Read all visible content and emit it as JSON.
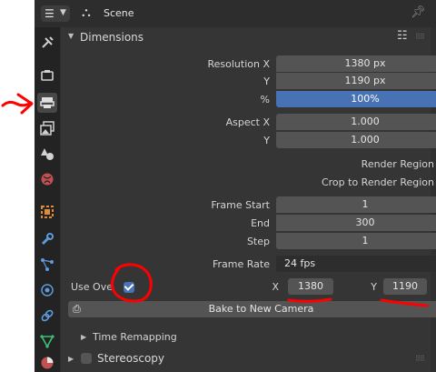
{
  "header": {
    "editor_icon": "properties-editor-icon",
    "scene_icon": "scene-icon",
    "title": "Scene",
    "pin_icon": "pin-icon"
  },
  "tabs": [
    {
      "name": "tool",
      "icon": "wrench-screwdriver-icon",
      "active": false
    },
    {
      "name": "render",
      "icon": "camera-back-icon",
      "active": false
    },
    {
      "name": "output",
      "icon": "printer-icon",
      "active": true
    },
    {
      "name": "view-layer",
      "icon": "images-icon",
      "active": false
    },
    {
      "name": "scene",
      "icon": "cone-sphere-icon",
      "active": false
    },
    {
      "name": "world",
      "icon": "globe-icon",
      "active": false
    },
    {
      "name": "object",
      "icon": "square-orange-icon",
      "active": false
    },
    {
      "name": "modifiers",
      "icon": "wrench-blue-icon",
      "active": false
    },
    {
      "name": "particles",
      "icon": "nodes-icon",
      "active": false
    },
    {
      "name": "physics",
      "icon": "orbit-icon",
      "active": false
    },
    {
      "name": "constraints",
      "icon": "link-icon",
      "active": false
    },
    {
      "name": "data",
      "icon": "triangle-green-icon",
      "active": false
    },
    {
      "name": "material",
      "icon": "sphere-red-icon",
      "active": false
    }
  ],
  "dimensions": {
    "title": "Dimensions",
    "resolution_x_label": "Resolution X",
    "resolution_x": "1380 px",
    "resolution_y_label": "Y",
    "resolution_y": "1190 px",
    "percent_label": "%",
    "percent": "100%",
    "aspect_x_label": "Aspect X",
    "aspect_x": "1.000",
    "aspect_y_label": "Y",
    "aspect_y": "1.000",
    "render_region_label": "Render Region",
    "render_region_checked": true,
    "crop_label": "Crop to Render Region",
    "crop_checked": false,
    "frame_start_label": "Frame Start",
    "frame_start": "1",
    "end_label": "End",
    "end": "300",
    "step_label": "Step",
    "step": "1",
    "frame_rate_label": "Frame Rate",
    "frame_rate": "24 fps",
    "use_override_label": "Use Ove",
    "use_override_checked": true,
    "override_x_label": "X",
    "override_x": "1380",
    "override_y_label": "Y",
    "override_y": "1190",
    "bake_button": "Bake to New Camera"
  },
  "time_remapping": {
    "title": "Time Remapping"
  },
  "stereoscopy": {
    "title": "Stereoscopy",
    "checked": false
  },
  "colors": {
    "accent": "#4772b3",
    "annotation": "#ff0000",
    "panel": "#353535",
    "field": "#545454"
  }
}
